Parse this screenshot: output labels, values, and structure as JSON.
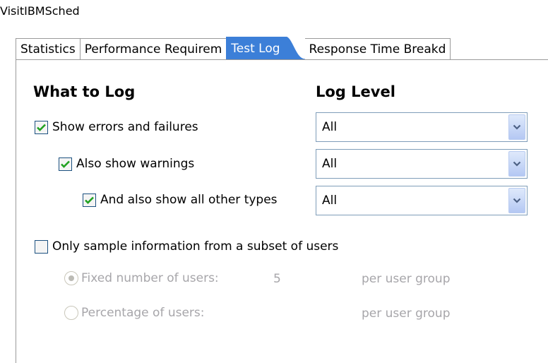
{
  "window": {
    "title": "VisitIBMSched"
  },
  "tabs": [
    {
      "label": "Statistics",
      "active": false
    },
    {
      "label": "Performance Requirem",
      "active": false
    },
    {
      "label": "Test Log",
      "active": true
    },
    {
      "label": "Response Time Breakd",
      "active": false
    }
  ],
  "log": {
    "what_heading": "What to Log",
    "level_heading": "Log Level",
    "items": [
      {
        "label": "Show errors and failures",
        "checked": true,
        "level": "All"
      },
      {
        "label": "Also show warnings",
        "checked": true,
        "level": "All"
      },
      {
        "label": "And also show all other types",
        "checked": true,
        "level": "All"
      }
    ]
  },
  "sampling": {
    "label": "Only sample information from a subset of users",
    "checked": false,
    "fixed": {
      "label": "Fixed number of users:",
      "value": "5",
      "suffix": "per user group",
      "selected": true
    },
    "percentage": {
      "label": "Percentage of users:",
      "suffix": "per user group",
      "selected": false
    }
  },
  "colors": {
    "active_tab": "#3c7fd8",
    "checkbox_check": "#21a121",
    "disabled_text": "#a7a6aa"
  }
}
